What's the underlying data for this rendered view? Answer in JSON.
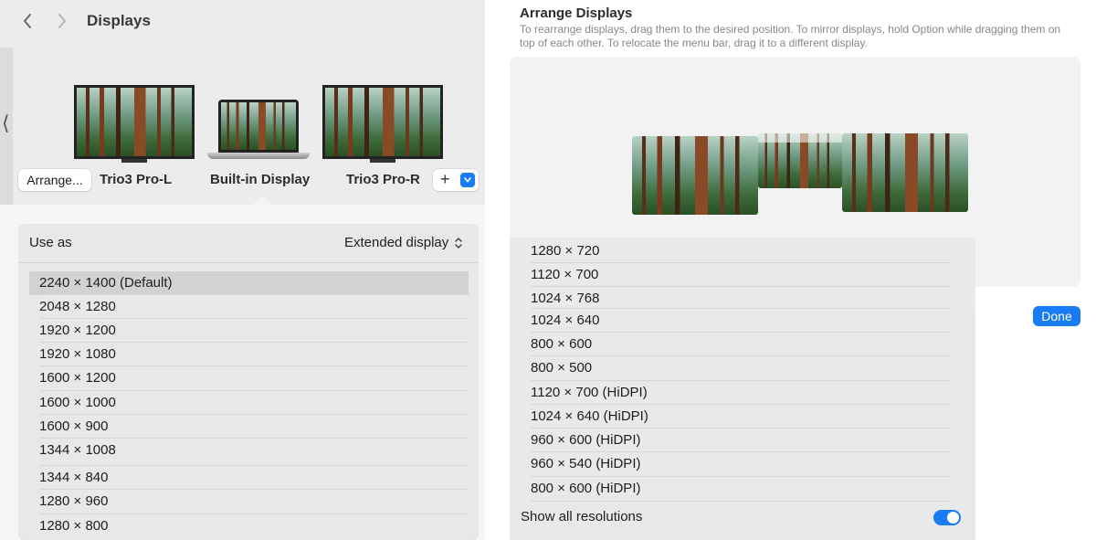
{
  "window": {
    "title": "Displays"
  },
  "displays": [
    {
      "label": "Trio3 Pro-L"
    },
    {
      "label": "Built-in Display"
    },
    {
      "label": "Trio3 Pro-R"
    }
  ],
  "buttons": {
    "arrange": "Arrange...",
    "add": "+",
    "done": "Done"
  },
  "use_as": {
    "label": "Use as",
    "value": "Extended display"
  },
  "resolutions_left": [
    "2240 × 1400 (Default)",
    "2048 × 1280",
    "1920 × 1200",
    "1920 × 1080",
    "1600 × 1200",
    "1600 × 1000",
    "1600 × 900",
    "1344 × 1008",
    "1344 × 840",
    "1280 × 960",
    "1280 × 800"
  ],
  "selected_resolution": "2240 × 1400 (Default)",
  "arrange_sheet": {
    "title": "Arrange Displays",
    "description": "To rearrange displays, drag them to the desired position. To mirror displays, hold Option while dragging them on top of each other. To relocate the menu bar, drag it to a different display."
  },
  "resolutions_right": [
    "1280 × 720",
    "1120 × 700",
    "1024 × 768",
    "1024 × 640",
    "800 × 600",
    "800 × 500",
    "1120 × 700 (HiDPI)",
    "1024 × 640 (HiDPI)",
    "960 × 600 (HiDPI)",
    "960 × 540 (HiDPI)",
    "800 × 600 (HiDPI)"
  ],
  "show_all": {
    "label": "Show all resolutions",
    "enabled": true
  },
  "colors": {
    "accent": "#1a7cf5",
    "sidebar_bg": "#ececec",
    "selected_row": "#d2d2d5"
  }
}
